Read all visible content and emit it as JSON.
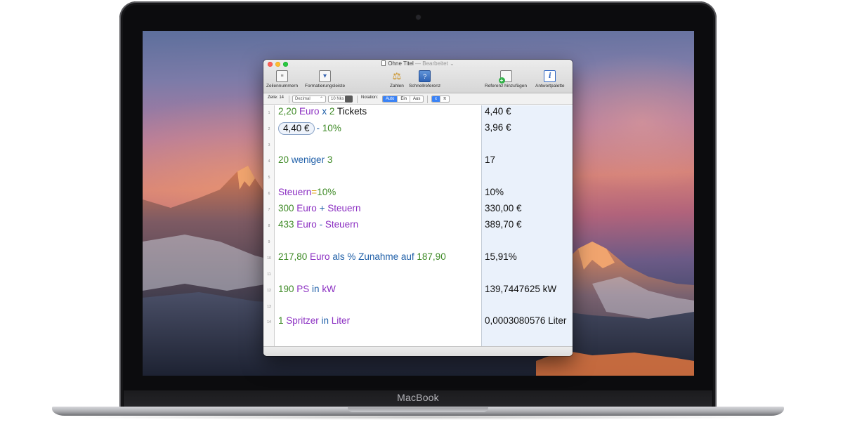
{
  "device": {
    "brand": "MacBook"
  },
  "window": {
    "title": "Ohne Titel",
    "separator": "—",
    "status": "Bearbeitet",
    "status_chevron": "⌄"
  },
  "toolbar": {
    "items": [
      {
        "label": "Zeilennummern",
        "icon": "line-numbers-icon",
        "glyph": "≡"
      },
      {
        "label": "Formatierungsleiste",
        "icon": "format-bar-icon",
        "glyph": "▾"
      },
      {
        "label": "Zahlen",
        "icon": "scale-icon",
        "glyph": "⚖"
      },
      {
        "label": "Schnellreferenz",
        "icon": "reference-book-icon",
        "glyph": "?"
      },
      {
        "label": "Referenz hinzufügen",
        "icon": "add-reference-icon",
        "glyph": "+"
      },
      {
        "label": "Antwortpalette",
        "icon": "info-icon",
        "glyph": "i"
      }
    ]
  },
  "format_bar": {
    "line_label": "Zeile: 14",
    "format_select": "Dezimal",
    "format_stepper": "⌃",
    "places": "10 Nks",
    "notation_label": "Notation:",
    "notation_options": [
      "Auto",
      "Ein",
      "Aus"
    ],
    "notation_selected": "Auto",
    "extra_buttons": [
      "x",
      "π"
    ]
  },
  "lines": [
    {
      "num": "1",
      "tokens": [
        [
          "2,20",
          "num"
        ],
        [
          " Euro",
          "unit"
        ],
        [
          " x ",
          "op"
        ],
        [
          "2",
          "num"
        ],
        [
          " Tickets",
          "txt"
        ]
      ],
      "result": "4,40 €"
    },
    {
      "num": "2",
      "token_chip": "4,40 €",
      "tokens": [
        [
          "- ",
          "op"
        ],
        [
          "10%",
          "num"
        ]
      ],
      "result": "3,96 €"
    },
    {
      "num": "3",
      "tokens": [],
      "result": ""
    },
    {
      "num": "4",
      "tokens": [
        [
          "20",
          "num"
        ],
        [
          " weniger ",
          "op"
        ],
        [
          "3",
          "num"
        ]
      ],
      "result": "17"
    },
    {
      "num": "5",
      "tokens": [],
      "result": ""
    },
    {
      "num": "6",
      "tokens": [
        [
          "Steuern",
          "var"
        ],
        [
          "=",
          "eq"
        ],
        [
          "10%",
          "num"
        ]
      ],
      "result": "10%"
    },
    {
      "num": "7",
      "tokens": [
        [
          "300",
          "num"
        ],
        [
          " Euro",
          "unit"
        ],
        [
          " + ",
          "op"
        ],
        [
          "Steuern",
          "var"
        ]
      ],
      "result": "330,00 €"
    },
    {
      "num": "8",
      "tokens": [
        [
          "433",
          "num"
        ],
        [
          " Euro",
          "unit"
        ],
        [
          " - ",
          "op"
        ],
        [
          "Steuern",
          "var"
        ]
      ],
      "result": "389,70 €"
    },
    {
      "num": "9",
      "tokens": [],
      "result": ""
    },
    {
      "num": "10",
      "tokens": [
        [
          "217,80",
          "num"
        ],
        [
          " Euro",
          "unit"
        ],
        [
          " als % Zunahme auf ",
          "op"
        ],
        [
          "187,90",
          "num"
        ]
      ],
      "result": "15,91%"
    },
    {
      "num": "11",
      "tokens": [],
      "result": ""
    },
    {
      "num": "12",
      "tokens": [
        [
          "190",
          "num"
        ],
        [
          " PS",
          "unit"
        ],
        [
          " in ",
          "op"
        ],
        [
          "kW",
          "unit"
        ]
      ],
      "result": "139,7447625 kW"
    },
    {
      "num": "13",
      "tokens": [],
      "result": ""
    },
    {
      "num": "14",
      "tokens": [
        [
          "1",
          "num"
        ],
        [
          " Spritzer",
          "unit"
        ],
        [
          " in ",
          "op"
        ],
        [
          "Liter",
          "unit"
        ]
      ],
      "result": "0,0003080576 Liter"
    }
  ],
  "colors": {
    "number": "#3e8a26",
    "unit": "#8b2fc2",
    "operator": "#1f5fa8",
    "results_bg": "#eaf1fb",
    "accent": "#3a82f6"
  }
}
